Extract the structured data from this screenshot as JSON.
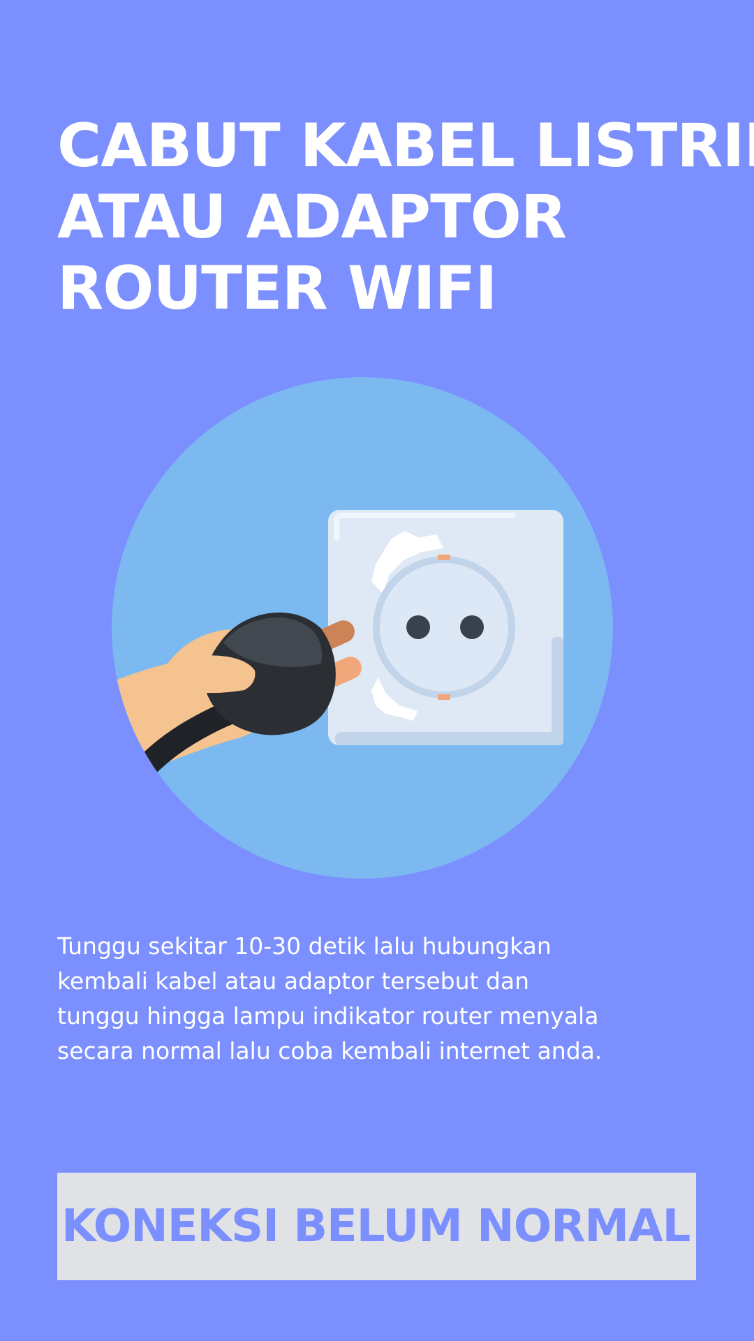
{
  "title": {
    "line1": "CABUT KABEL LISTRIK",
    "line2": "ATAU ADAPTOR",
    "line3": "ROUTER WIFI"
  },
  "illustration": {
    "icon": "unplug-power-socket-icon",
    "circle_color": "#7bb9f0"
  },
  "description": {
    "line1": "Tunggu sekitar 10-30 detik lalu hubungkan",
    "line2": "kembali kabel atau adaptor tersebut dan",
    "line3": "tunggu hingga lampu indikator router menyala",
    "line4": "secara normal lalu coba kembali internet anda."
  },
  "cta": {
    "label": "KONEKSI BELUM NORMAL ?"
  },
  "colors": {
    "background": "#7b8fff",
    "button_background": "#e1e2e6",
    "button_text": "#7b8fff",
    "text": "#ffffff"
  }
}
